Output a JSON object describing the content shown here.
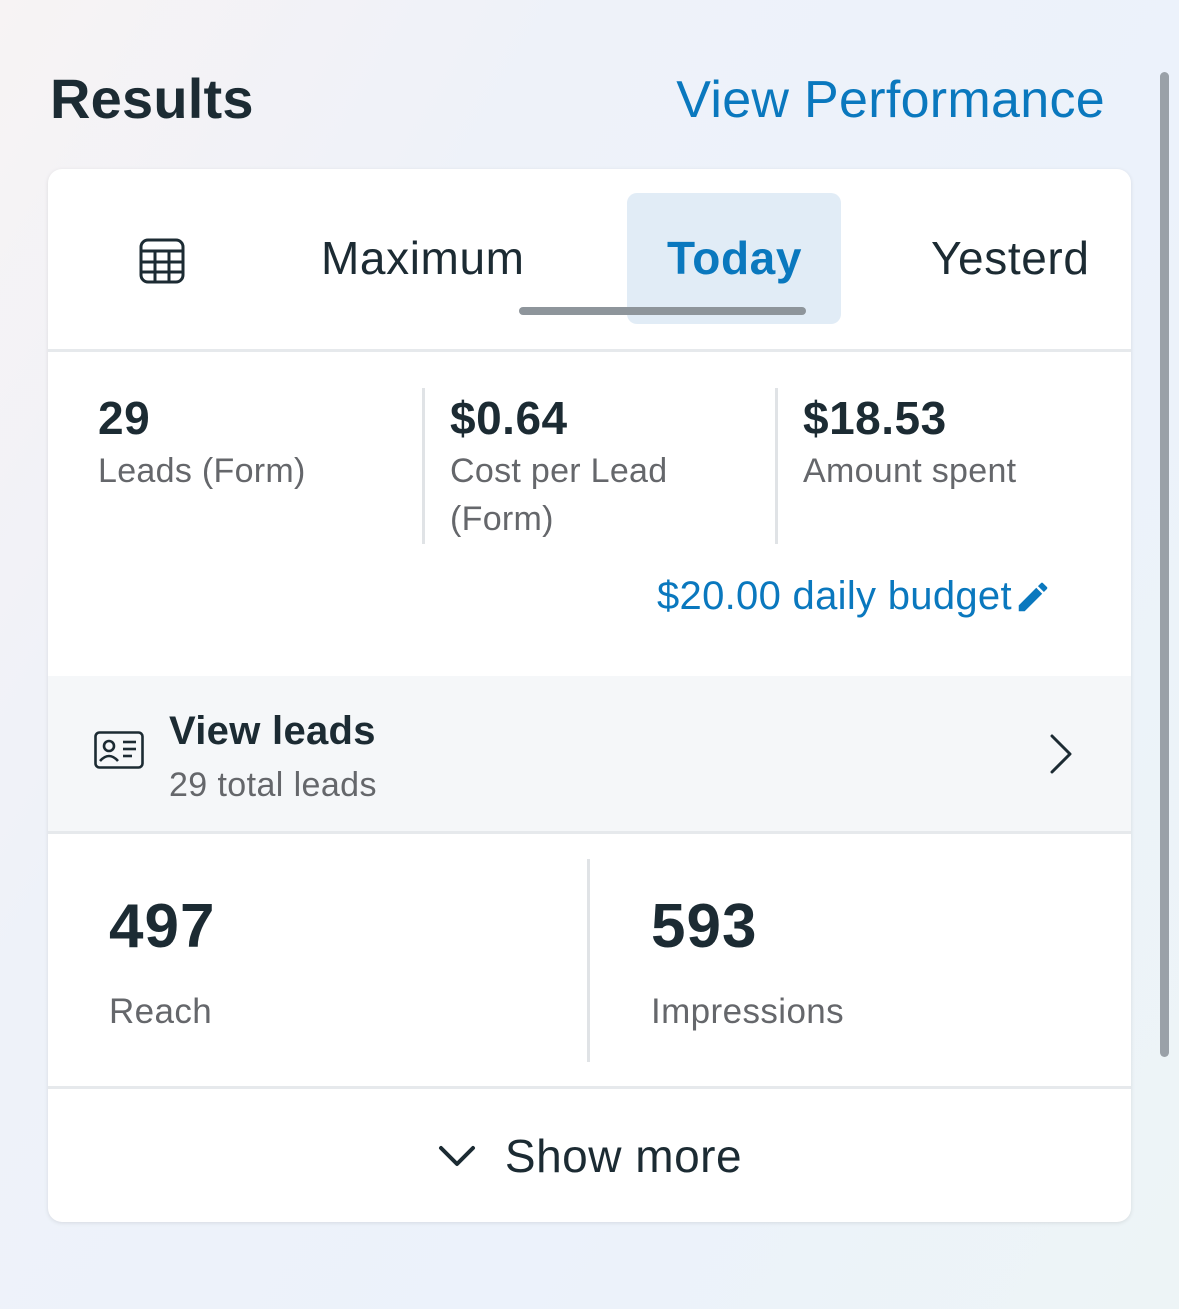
{
  "header": {
    "title": "Results",
    "view_performance": "View Performance"
  },
  "tabs": {
    "items": [
      "Maximum",
      "Today",
      "Yesterd"
    ],
    "selected": "Today"
  },
  "metrics": [
    {
      "value": "29",
      "label": "Leads (Form)"
    },
    {
      "value": "$0.64",
      "label": "Cost per Lead (Form)"
    },
    {
      "value": "$18.53",
      "label": "Amount spent"
    }
  ],
  "budget": {
    "label": "$20.00 daily budget"
  },
  "leads": {
    "title": "View leads",
    "subtitle": "29 total leads"
  },
  "stats": [
    {
      "value": "497",
      "label": "Reach"
    },
    {
      "value": "593",
      "label": "Impressions"
    }
  ],
  "show_more": {
    "label": "Show more"
  },
  "colors": {
    "accent": "#0a78be",
    "text": "#1c2b33",
    "secondary": "#65676b",
    "selected_tab_bg": "#e1ecf6"
  }
}
